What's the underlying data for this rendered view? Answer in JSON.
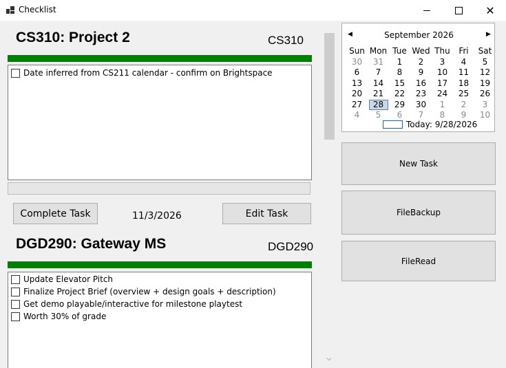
{
  "window": {
    "title": "Checklist",
    "close_symbol": "✕"
  },
  "tasks": [
    {
      "title": "CS310: Project 2",
      "course": "CS310",
      "progress": 1.0,
      "items": [
        "Date inferred from CS211 calendar - confirm on Brightspace"
      ],
      "complete_label": "Complete Task",
      "due": "11/3/2026",
      "edit_label": "Edit Task"
    },
    {
      "title": "DGD290: Gateway MS",
      "course": "DGD290",
      "progress": 1.0,
      "items": [
        "Update Elevator Pitch",
        "Finalize Project Brief (overview + design goals + description)",
        "Get demo playable/interactive for milestone playtest",
        "Worth 30% of grade"
      ]
    }
  ],
  "calendar": {
    "month_label": "September 2026",
    "day_names": [
      "Sun",
      "Mon",
      "Tue",
      "Wed",
      "Thu",
      "Fri",
      "Sat"
    ],
    "weeks": [
      [
        "30",
        "31",
        "1",
        "2",
        "3",
        "4",
        "5"
      ],
      [
        "6",
        "7",
        "8",
        "9",
        "10",
        "11",
        "12"
      ],
      [
        "13",
        "14",
        "15",
        "16",
        "17",
        "18",
        "19"
      ],
      [
        "20",
        "21",
        "22",
        "23",
        "24",
        "25",
        "26"
      ],
      [
        "27",
        "28",
        "29",
        "30",
        "1",
        "2",
        "3"
      ],
      [
        "4",
        "5",
        "6",
        "7",
        "8",
        "9",
        "10"
      ]
    ],
    "selected": "28",
    "today_label": "Today: 9/28/2026"
  },
  "actions": {
    "new_task": "New Task",
    "file_backup": "FileBackup",
    "file_read": "FileRead"
  },
  "colors": {
    "progress": "#008000",
    "selection": "#c8d8ea"
  }
}
